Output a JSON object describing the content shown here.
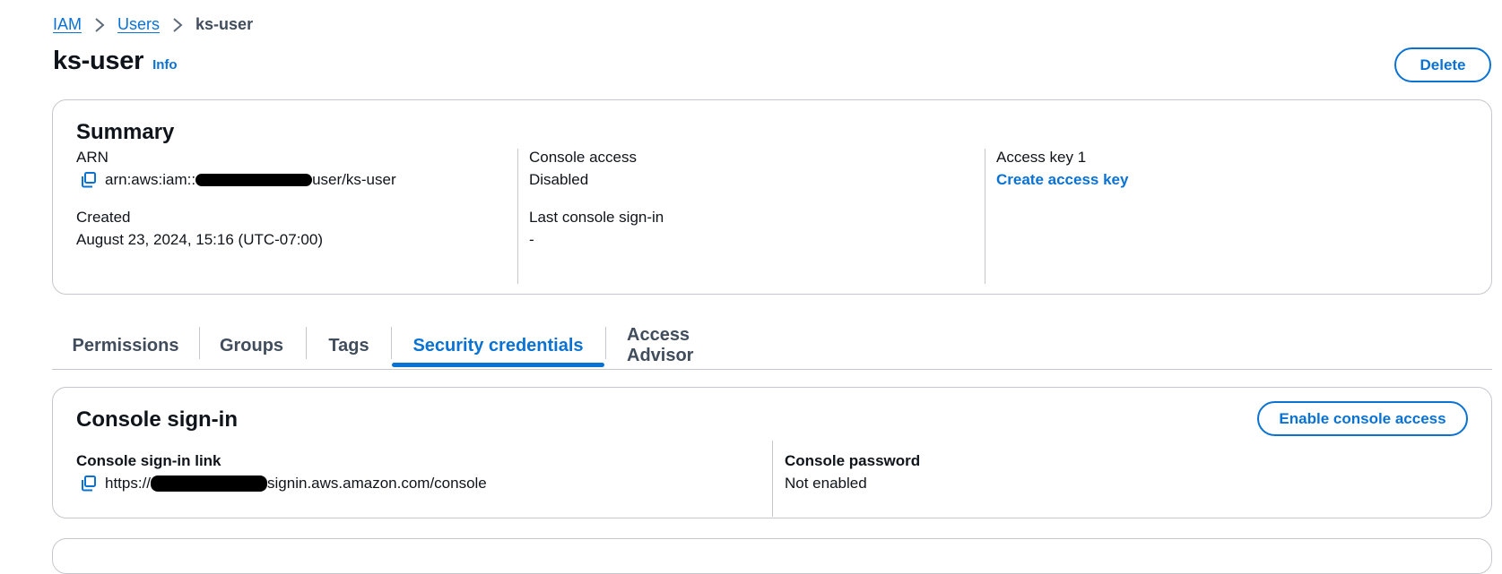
{
  "breadcrumb": {
    "items": [
      {
        "label": "IAM"
      },
      {
        "label": "Users"
      }
    ],
    "current": "ks-user"
  },
  "header": {
    "title": "ks-user",
    "info_label": "Info",
    "delete_label": "Delete"
  },
  "summary": {
    "title": "Summary",
    "arn": {
      "label": "ARN",
      "value_prefix": "arn:aws:iam::",
      "value_suffix": "user/ks-user"
    },
    "created": {
      "label": "Created",
      "value": "August 23, 2024, 15:16 (UTC-07:00)"
    },
    "console_access": {
      "label": "Console access",
      "value": "Disabled"
    },
    "last_signin": {
      "label": "Last console sign-in",
      "value": "-"
    },
    "access_key": {
      "label": "Access key 1",
      "link": "Create access key"
    }
  },
  "tabs": [
    {
      "label": "Permissions",
      "active": false
    },
    {
      "label": "Groups",
      "active": false
    },
    {
      "label": "Tags",
      "active": false
    },
    {
      "label": "Security credentials",
      "active": true
    },
    {
      "label": "Access Advisor",
      "active": false
    }
  ],
  "console_signin": {
    "title": "Console sign-in",
    "enable_label": "Enable console access",
    "link": {
      "label": "Console sign-in link",
      "value_prefix": "https://",
      "value_suffix": "signin.aws.amazon.com/console"
    },
    "password": {
      "label": "Console password",
      "value": "Not enabled"
    }
  },
  "colors": {
    "accent": "#0972d3",
    "border": "#c6c6cd",
    "text": "#0f141a"
  },
  "icons": {
    "copy": "copy-icon",
    "breadcrumb_separator": "chevron-right-icon"
  }
}
